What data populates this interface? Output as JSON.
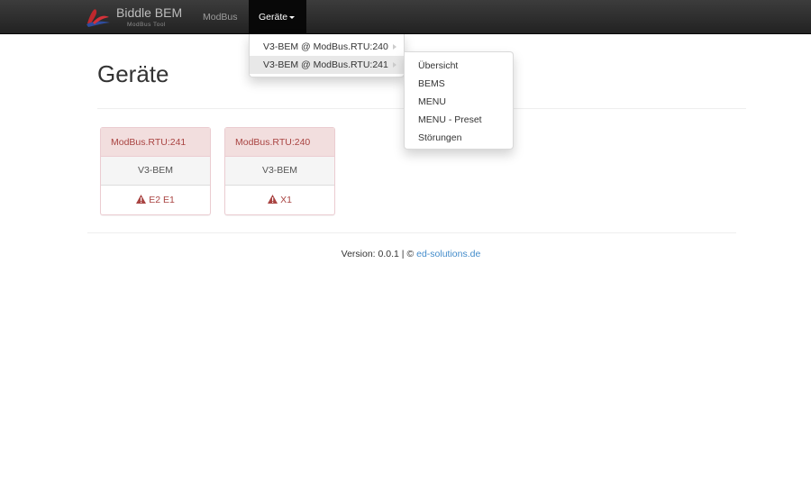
{
  "navbar": {
    "brand_title": "Biddle BEM",
    "brand_subtitle": "ModBus Tool",
    "nav_modbus": "ModBus",
    "nav_geraete": "Geräte"
  },
  "dropdown": {
    "items": [
      {
        "label": "V3-BEM @ ModBus.RTU:240"
      },
      {
        "label": "V3-BEM @ ModBus.RTU:241"
      }
    ]
  },
  "submenu": {
    "items": [
      {
        "label": "Übersicht"
      },
      {
        "label": "BEMS"
      },
      {
        "label": "MENU"
      },
      {
        "label": "MENU - Preset"
      },
      {
        "label": "Störungen"
      }
    ]
  },
  "page": {
    "title": "Geräte"
  },
  "devices": [
    {
      "address": "ModBus.RTU:241",
      "type": "V3-BEM",
      "errors": "E2 E1"
    },
    {
      "address": "ModBus.RTU:240",
      "type": "V3-BEM",
      "errors": "X1"
    }
  ],
  "footer": {
    "version_text": "Version: 0.0.1 |",
    "copyright": "©",
    "link_text": "ed-solutions.de"
  },
  "colors": {
    "navbar": "#222222",
    "danger_text": "#a94442",
    "danger_bg": "#f2dede",
    "link": "#428bca"
  },
  "icons": {
    "brand": "brand-logo-icon",
    "warning": "warning-triangle-icon",
    "submenu": "submenu-arrow-icon",
    "caret": "caret-down-icon"
  }
}
